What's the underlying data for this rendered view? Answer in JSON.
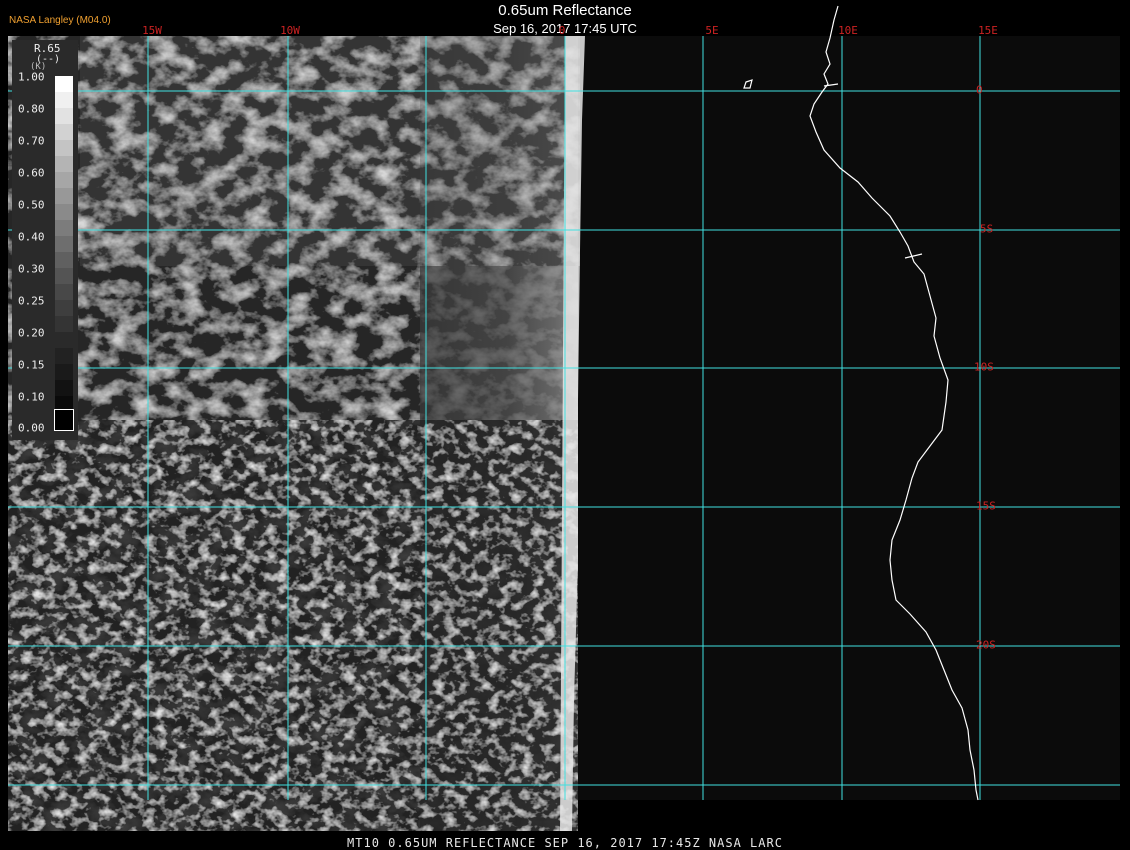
{
  "header": {
    "logo": "NASA Langley (M04.0)",
    "title": "0.65um Reflectance",
    "subtitle": "Sep 16, 2017 17:45 UTC"
  },
  "footer": {
    "text": "MT10  0.65UM REFLECTANCE   SEP 16, 2017 17:45Z   NASA LARC"
  },
  "legend": {
    "var": "R.65",
    "unit": "(--)",
    "k_label": "(K)",
    "ticks": [
      "1.00",
      "0.80",
      "0.70",
      "0.60",
      "0.50",
      "0.40",
      "0.30",
      "0.25",
      "0.20",
      "0.15",
      "0.10",
      "0.00"
    ]
  },
  "map": {
    "lon_labels": [
      "15W",
      "10W",
      "0",
      "5E",
      "10E",
      "15E"
    ],
    "lat_labels": [
      "0",
      "5S",
      "10S",
      "15S",
      "20S"
    ],
    "grid_color": "#40e0e0",
    "label_color": "#cc2222",
    "coastline_color": "#ffffff",
    "background_color": "#000000",
    "space_color": "#0b0b0b"
  }
}
